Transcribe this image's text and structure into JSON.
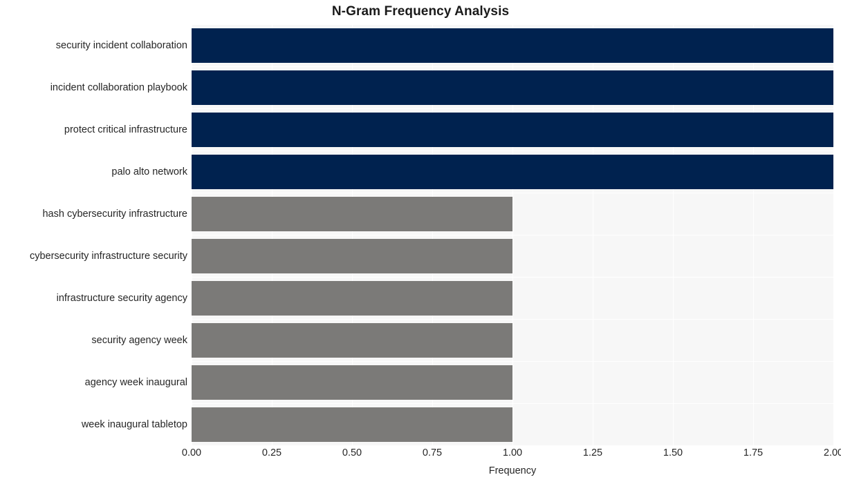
{
  "chart_data": {
    "type": "bar",
    "orientation": "horizontal",
    "title": "N-Gram Frequency Analysis",
    "xlabel": "Frequency",
    "ylabel": "",
    "xlim": [
      0,
      2
    ],
    "ylim": [
      0,
      10
    ],
    "grid": true,
    "legend": null,
    "xticks": [
      "0.00",
      "0.25",
      "0.50",
      "0.75",
      "1.00",
      "1.25",
      "1.50",
      "1.75",
      "2.00"
    ],
    "xtick_values": [
      0,
      0.25,
      0.5,
      0.75,
      1.0,
      1.25,
      1.5,
      1.75,
      2.0
    ],
    "categories": [
      "security incident collaboration",
      "incident collaboration playbook",
      "protect critical infrastructure",
      "palo alto network",
      "hash cybersecurity infrastructure",
      "cybersecurity infrastructure security",
      "infrastructure security agency",
      "security agency week",
      "agency week inaugural",
      "week inaugural tabletop"
    ],
    "values": [
      2,
      2,
      2,
      2,
      1,
      1,
      1,
      1,
      1,
      1
    ],
    "bar_colors": [
      "#00224f",
      "#00224f",
      "#00224f",
      "#00224f",
      "#7b7a78",
      "#7b7a78",
      "#7b7a78",
      "#7b7a78",
      "#7b7a78",
      "#7b7a78"
    ],
    "palette": {
      "high": "#00224f",
      "low": "#7b7a78",
      "plot_background": "#f7f7f7",
      "figure_background": "#ffffff",
      "gridline": "#ffffff",
      "text": "#262626",
      "title": "#1a1a1a"
    }
  }
}
